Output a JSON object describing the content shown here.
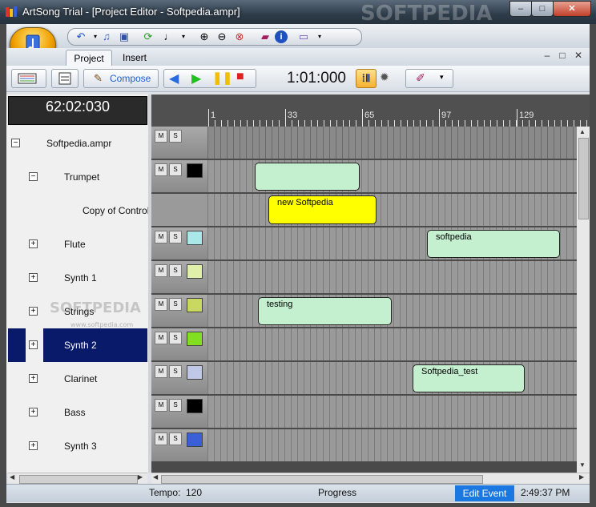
{
  "window": {
    "title": "ArtSong Trial - [Project Editor - Softpedia.ampr]",
    "minimize": "–",
    "maximize": "□",
    "close": "✕"
  },
  "ribbon": {
    "tabs": [
      "Project",
      "Insert"
    ],
    "mdi_buttons": [
      "–",
      "□",
      "✕"
    ],
    "compose_label": "Compose",
    "time_display": "1:01:000"
  },
  "left": {
    "counter": "62:02:030",
    "tracks": [
      {
        "label": "Softpedia.ampr",
        "expander": "−",
        "level": 0
      },
      {
        "label": "Trumpet",
        "expander": "−",
        "level": 1
      },
      {
        "label": "Copy of Controlle",
        "expander": "",
        "level": 2
      },
      {
        "label": "Flute",
        "expander": "+",
        "level": 1
      },
      {
        "label": "Synth 1",
        "expander": "+",
        "level": 1
      },
      {
        "label": "Strings",
        "expander": "+",
        "level": 1
      },
      {
        "label": "Synth 2",
        "expander": "+",
        "level": 1,
        "selected": true
      },
      {
        "label": "Clarinet",
        "expander": "+",
        "level": 1
      },
      {
        "label": "Bass",
        "expander": "+",
        "level": 1
      },
      {
        "label": "Synth 3",
        "expander": "+",
        "level": 1
      }
    ]
  },
  "ruler": {
    "labels": [
      "1",
      "33",
      "65",
      "97",
      "129"
    ]
  },
  "lanes": {
    "mute": "M",
    "solo": "S",
    "colors": [
      "",
      "#000000",
      "",
      "#a8e8e8",
      "#e0f0a8",
      "#c8d860",
      "#80e020",
      "#c0c8e8",
      "#000000",
      "#3a60d8"
    ]
  },
  "clips": [
    {
      "text": "",
      "color": "green"
    },
    {
      "text": "new Softpedia",
      "color": "yellow"
    },
    {
      "text": "softpedia",
      "color": "green"
    },
    {
      "text": "testing",
      "color": "green"
    },
    {
      "text": "Softpedia_test",
      "color": "green"
    }
  ],
  "status": {
    "tempo_label": "Tempo:",
    "tempo_value": "120",
    "progress": "Progress",
    "edit_event": "Edit Event",
    "time": "2:49:37 PM"
  },
  "watermark": {
    "title": "SOFTPEDIA",
    "left": "SOFTPEDIA",
    "url": "www.softpedia.com"
  }
}
